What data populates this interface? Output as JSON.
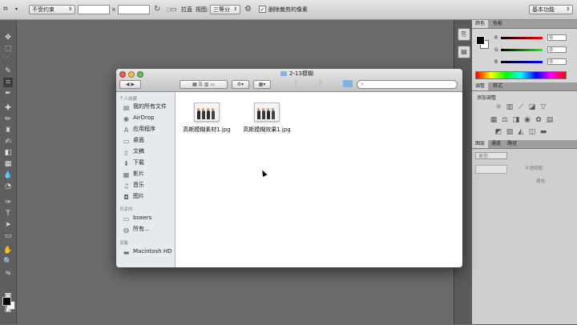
{
  "options_bar": {
    "constraint_select": "不受约束",
    "times_symbol": "×",
    "straighten_label": "拉直",
    "view_label": "视图:",
    "view_select": "三等分",
    "delete_cropped_checkbox": "删除裁剪的像素",
    "workspace_select": "基本功能"
  },
  "finder": {
    "title": "2-13模糊",
    "sidebar": {
      "sections": [
        {
          "header": "个人收藏",
          "items": [
            {
              "label": "我的所有文件",
              "icon": "all-files-icon"
            },
            {
              "label": "AirDrop",
              "icon": "airdrop-icon"
            },
            {
              "label": "应用程序",
              "icon": "applications-icon"
            },
            {
              "label": "桌面",
              "icon": "desktop-icon"
            },
            {
              "label": "文稿",
              "icon": "documents-icon"
            },
            {
              "label": "下载",
              "icon": "downloads-icon"
            },
            {
              "label": "影片",
              "icon": "movies-icon"
            },
            {
              "label": "音乐",
              "icon": "music-icon"
            },
            {
              "label": "图片",
              "icon": "pictures-icon"
            }
          ]
        },
        {
          "header": "共享的",
          "items": [
            {
              "label": "boxers",
              "icon": "computer-icon"
            },
            {
              "label": "所有...",
              "icon": "network-icon"
            }
          ]
        },
        {
          "header": "设备",
          "items": [
            {
              "label": "Macintosh HD",
              "icon": "hard-drive-icon"
            }
          ]
        }
      ]
    },
    "files": [
      {
        "name": "高斯模糊素材1.jpg"
      },
      {
        "name": "高斯模糊效果1.jpg"
      }
    ]
  },
  "panels": {
    "color_tabs": [
      "颜色",
      "色板"
    ],
    "rgb": [
      {
        "label": "R",
        "value": "0"
      },
      {
        "label": "G",
        "value": "0"
      },
      {
        "label": "B",
        "value": "0"
      }
    ],
    "adjust_tabs": [
      "调整",
      "样式"
    ],
    "adjust_title": "添加调整",
    "layers_tabs": [
      "图层",
      "通道",
      "路径"
    ],
    "layers_kind": "类型",
    "opacity_label": "不透明度:",
    "fill_label": "填充:"
  },
  "colors": {
    "fg_swatch": "#000000",
    "bg_swatch": "#ffffff",
    "canvas_bg": "#6b6b6b"
  }
}
